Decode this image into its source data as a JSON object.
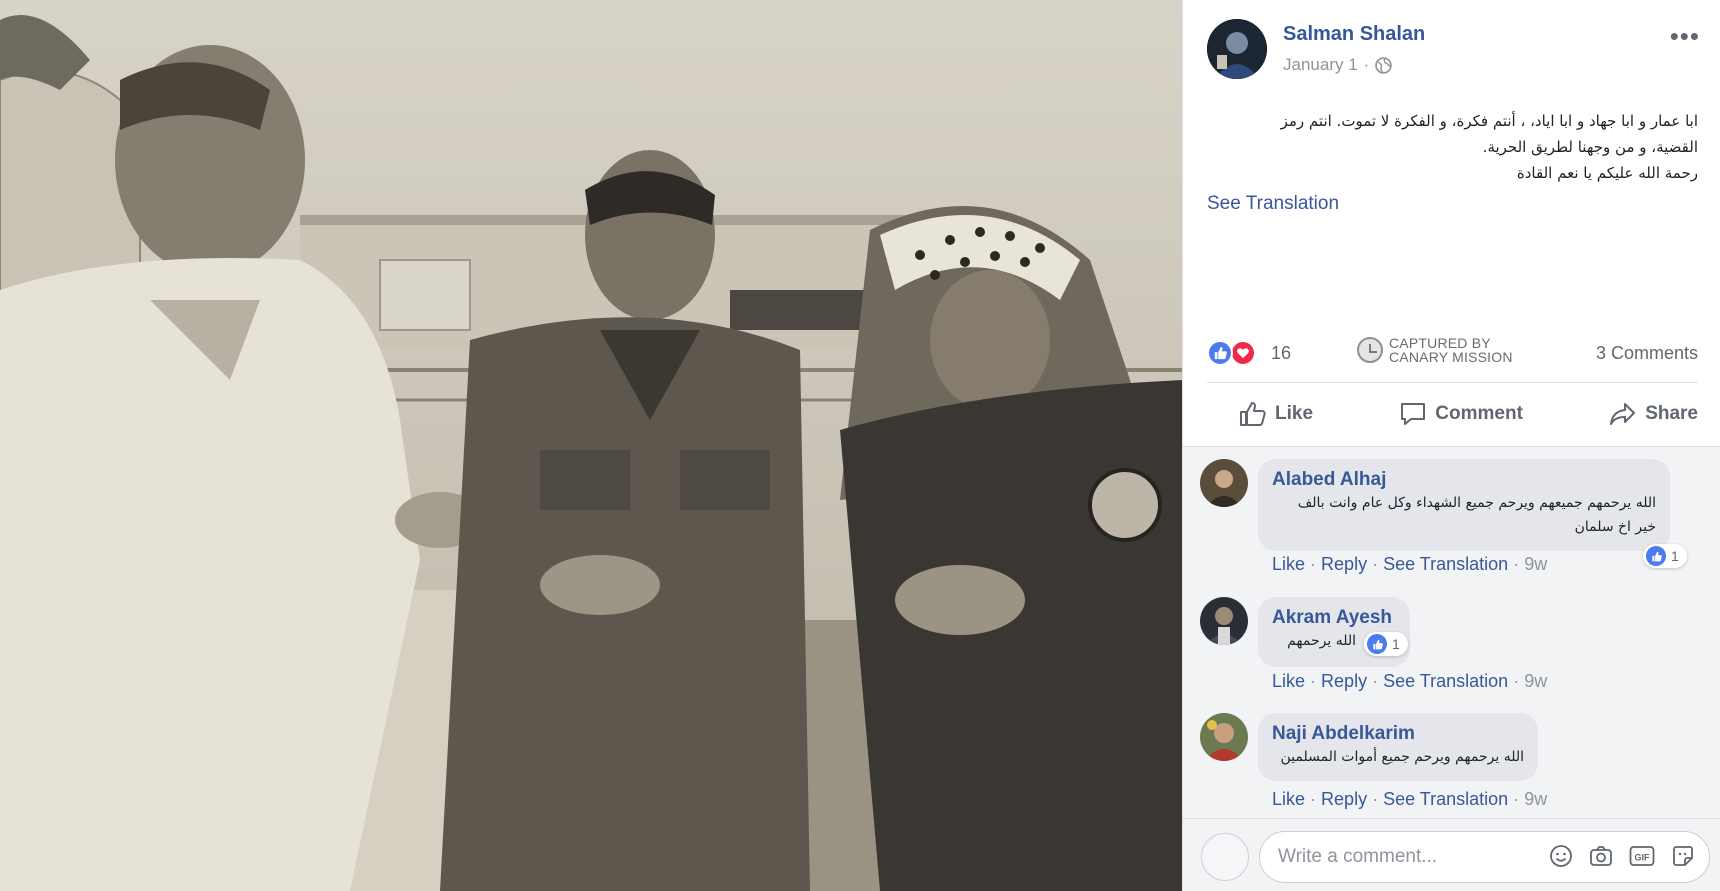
{
  "post": {
    "author": "Salman Shalan",
    "date": "January 1",
    "date_separator": "·",
    "more_label": "•••",
    "text_lines": [
      "ابا عمار و ابا جهاد و ابا اياد، ، أنتم فكرة، و الفكرة لا تموت. انتم رمز",
      "القضية، و من وجهنا لطريق الحرية.",
      "رحمة الله عليكم يا نعم القادة"
    ],
    "see_translation": "See Translation"
  },
  "reactions": {
    "count": "16",
    "like_color": "#4a7cf0",
    "love_color": "#f0284a",
    "captured_line1": "CAPTURED BY",
    "captured_line2": "CANARY MISSION",
    "comments_count": "3 Comments"
  },
  "actions": {
    "like": "Like",
    "comment": "Comment",
    "share": "Share"
  },
  "comments": [
    {
      "name": "Alabed Alhaj",
      "text_lines": [
        "الله يرحمهم جميعهم ويرحم جميع الشهداء وكل عام وانت بالف",
        "خير اخ سلمان"
      ],
      "reaction_count": "1",
      "like": "Like",
      "reply": "Reply",
      "see_translation": "See Translation",
      "time": "9w"
    },
    {
      "name": "Akram Ayesh",
      "text_lines": [
        "الله يرحمهم"
      ],
      "reaction_count": "1",
      "like": "Like",
      "reply": "Reply",
      "see_translation": "See Translation",
      "time": "9w"
    },
    {
      "name": "Naji Abdelkarim",
      "text_lines": [
        "الله يرحمهم ويرحم جميع أموات المسلمين"
      ],
      "like": "Like",
      "reply": "Reply",
      "see_translation": "See Translation",
      "time": "9w"
    }
  ],
  "composer": {
    "placeholder": "Write a comment...",
    "icons": [
      "emoji-icon",
      "camera-icon",
      "gif-icon",
      "sticker-icon"
    ]
  },
  "colors": {
    "link": "#365899",
    "accent_blue": "#4a7cf0",
    "muted": "#90949c"
  }
}
